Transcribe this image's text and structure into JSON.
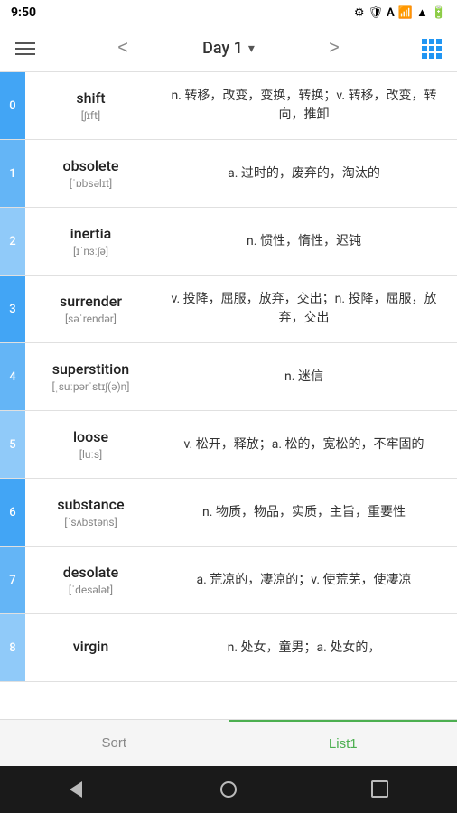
{
  "statusBar": {
    "time": "9:50",
    "icons": [
      "settings",
      "shield",
      "A",
      "wifi",
      "signal",
      "battery"
    ]
  },
  "navBar": {
    "menuIcon": "≡",
    "title": "Day 1",
    "backLabel": "<",
    "forwardLabel": ">",
    "chevron": "▾",
    "gridIcon": "grid"
  },
  "words": [
    {
      "index": "0",
      "word": "shift",
      "phonetic": "[ʃɪft]",
      "definition": "n. 转移，改变，变换，转换；v. 转移，改变，转向，推卸",
      "color": "#42a5f5"
    },
    {
      "index": "1",
      "word": "obsolete",
      "phonetic": "[ˈɒbsəlɪt]",
      "definition": "a. 过时的，废弃的，淘汰的",
      "color": "#64b5f6"
    },
    {
      "index": "2",
      "word": "inertia",
      "phonetic": "[ɪˈnɜːʃə]",
      "definition": "n. 惯性，惰性，迟钝",
      "color": "#90caf9"
    },
    {
      "index": "3",
      "word": "surrender",
      "phonetic": "[səˈrendər]",
      "definition": "v. 投降，屈服，放弃，交出；n. 投降，屈服，放弃，交出",
      "color": "#42a5f5"
    },
    {
      "index": "4",
      "word": "superstition",
      "phonetic": "[ˌsuːpərˈstɪʃ(ə)n]",
      "definition": "n. 迷信",
      "color": "#64b5f6"
    },
    {
      "index": "5",
      "word": "loose",
      "phonetic": "[luːs]",
      "definition": "v. 松开，释放；a. 松的，宽松的，不牢固的",
      "color": "#90caf9"
    },
    {
      "index": "6",
      "word": "substance",
      "phonetic": "[ˈsʌbstəns]",
      "definition": "n. 物质，物品，实质，主旨，重要性",
      "color": "#42a5f5"
    },
    {
      "index": "7",
      "word": "desolate",
      "phonetic": "[ˈdesələt]",
      "definition": "a. 荒凉的，凄凉的；v. 使荒芜，使凄凉",
      "color": "#64b5f6"
    },
    {
      "index": "8",
      "word": "virgin",
      "phonetic": "",
      "definition": "n. 处女，童男；a. 处女的，",
      "color": "#90caf9"
    }
  ],
  "bottomTabs": [
    {
      "label": "Sort",
      "active": false
    },
    {
      "label": "List1",
      "active": true
    }
  ]
}
